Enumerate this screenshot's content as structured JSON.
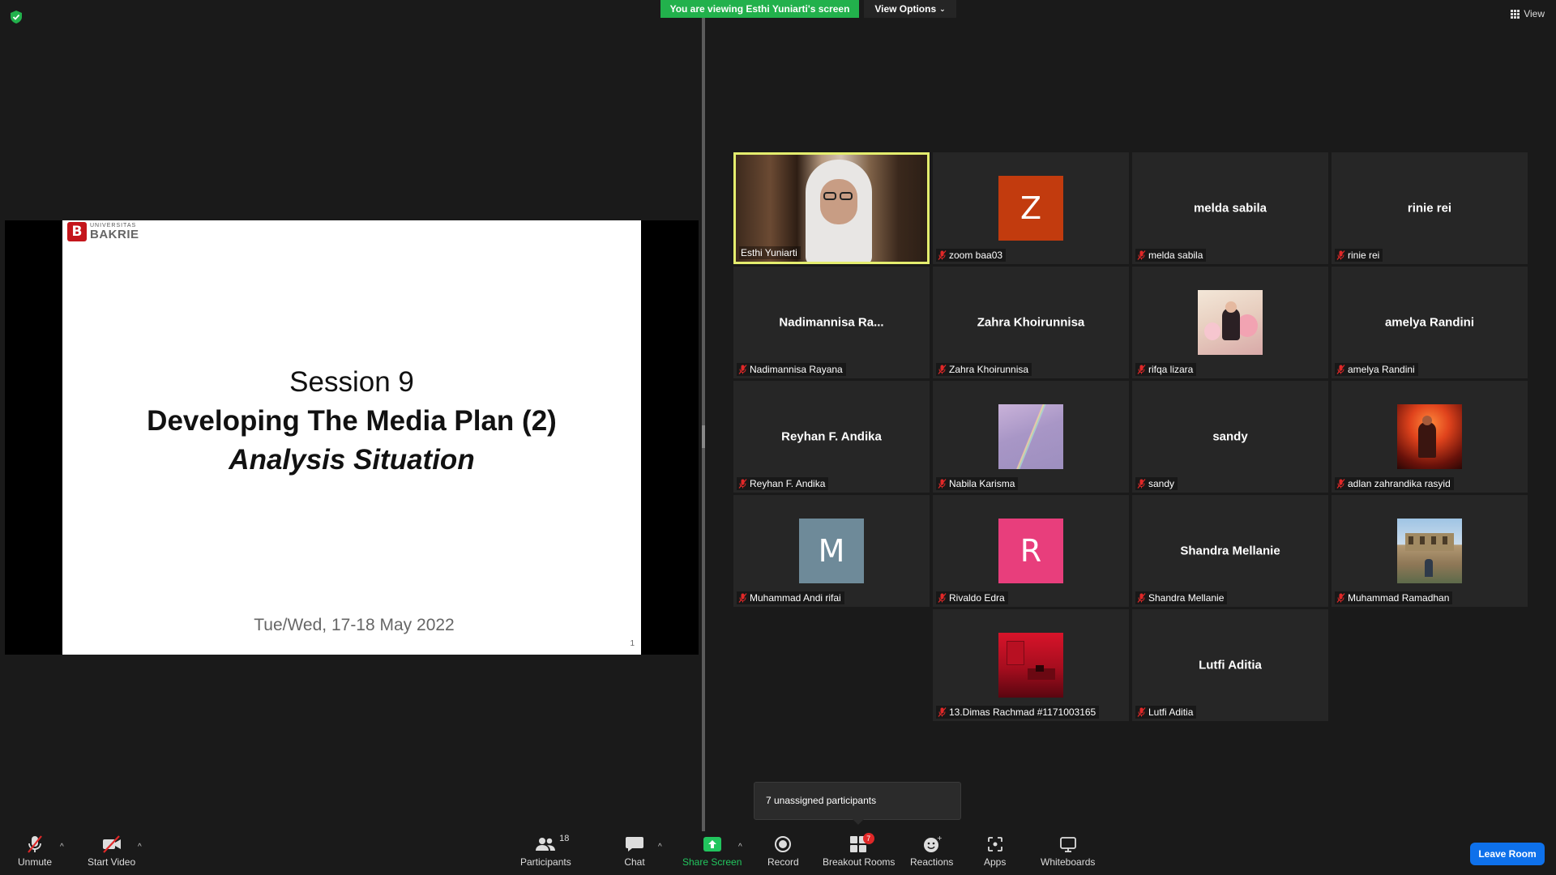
{
  "banner": {
    "viewing_text": "You are viewing Esthi Yuniarti's screen",
    "view_options": "View Options",
    "view_button": "View"
  },
  "slide": {
    "logo_small": "UNIVERSITAS",
    "logo_big": "BAKRIE",
    "logo_mark": "B",
    "title": "Session 9",
    "subtitle": "Developing The Media Plan (2)",
    "subtitle2": "Analysis Situation",
    "date": "Tue/Wed, 17-18 May 2022",
    "page_number": "1"
  },
  "participants": [
    {
      "name": "Esthi Yuniarti",
      "display": "",
      "type": "video",
      "active": true
    },
    {
      "name": "zoom baa03",
      "display": "Z",
      "type": "letter",
      "color": "#c23b0e"
    },
    {
      "name": "melda sabila",
      "display": "melda sabila",
      "type": "name"
    },
    {
      "name": "rinie rei",
      "display": "rinie rei",
      "type": "name"
    },
    {
      "name": "Nadimannisa Rayana",
      "display": "Nadimannisa  Ra...",
      "type": "name"
    },
    {
      "name": "Zahra Khoirunnisa",
      "display": "Zahra Khoirunnisa",
      "type": "name"
    },
    {
      "name": "rifqa lizara",
      "display": "",
      "type": "photo",
      "photo": "balloons"
    },
    {
      "name": "amelya Randini",
      "display": "amelya Randini",
      "type": "name"
    },
    {
      "name": "Reyhan F. Andika",
      "display": "Reyhan F. Andika",
      "type": "name"
    },
    {
      "name": "Nabila Karisma",
      "display": "",
      "type": "photo",
      "photo": "rainbow"
    },
    {
      "name": "sandy",
      "display": "sandy",
      "type": "name"
    },
    {
      "name": "adlan zahrandika rasyid",
      "display": "",
      "type": "photo",
      "photo": "fire"
    },
    {
      "name": "Muhammad Andi rifai",
      "display": "M",
      "type": "letter",
      "color": "#6e8a99"
    },
    {
      "name": "Rivaldo Edra",
      "display": "R",
      "type": "letter",
      "color": "#e83e7c"
    },
    {
      "name": "Shandra Mellanie",
      "display": "Shandra Mellanie",
      "type": "name"
    },
    {
      "name": "Muhammad Ramadhan",
      "display": "",
      "type": "photo",
      "photo": "building"
    },
    {
      "name": "13.Dimas Rachmad #1171003165",
      "display": "",
      "type": "photo",
      "photo": "red"
    },
    {
      "name": "Lutfi Aditia",
      "display": "Lutfi Aditia",
      "type": "name"
    }
  ],
  "tooltip": "7 unassigned participants",
  "toolbar": {
    "unmute": "Unmute",
    "start_video": "Start Video",
    "participants": "Participants",
    "participants_count": "18",
    "chat": "Chat",
    "share_screen": "Share Screen",
    "record": "Record",
    "breakout_rooms": "Breakout Rooms",
    "breakout_badge": "7",
    "reactions": "Reactions",
    "apps": "Apps",
    "whiteboards": "Whiteboards",
    "leave": "Leave Room"
  },
  "colors": {
    "banner_green": "#22b14c",
    "active_speaker_border": "#e4ed6e",
    "leave_blue": "#0e71eb",
    "tile_bg": "#262626"
  }
}
